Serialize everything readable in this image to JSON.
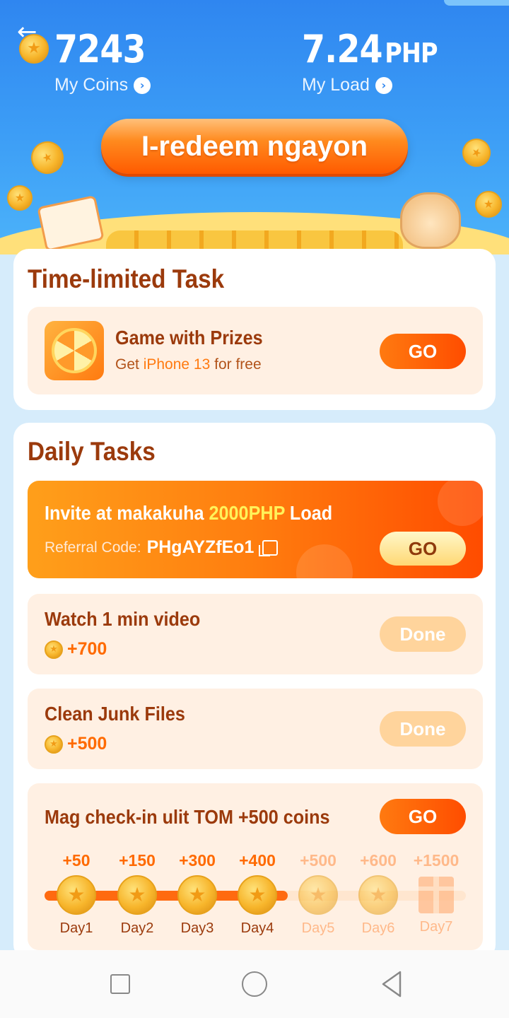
{
  "header": {
    "back_icon": "arrow-left-icon",
    "coins_value": "7243",
    "coins_label": "My Coins",
    "load_value": "7.24",
    "load_unit": "PHP",
    "load_label": "My Load",
    "redeem_label": "I-redeem ngayon"
  },
  "time_limited": {
    "title": "Time-limited Task",
    "task": {
      "icon": "prize-wheel-icon",
      "title": "Game with Prizes",
      "subtitle_prefix": "Get ",
      "subtitle_highlight": "iPhone 13",
      "subtitle_suffix": " for free",
      "button": "GO"
    }
  },
  "daily": {
    "title": "Daily Tasks",
    "invite": {
      "title_prefix": "Invite at makakuha ",
      "title_amount": "2000PHP",
      "title_suffix": " Load",
      "referral_label": "Referral Code:",
      "referral_code": "PHgAYZfEo1",
      "button": "GO"
    },
    "tasks": [
      {
        "title": "Watch 1 min video",
        "reward": "+700",
        "button": "Done"
      },
      {
        "title": "Clean Junk Files",
        "reward": "+500",
        "button": "Done"
      }
    ],
    "checkin": {
      "title": "Mag check-in ulit TOM +500 coins",
      "button": "GO",
      "completed_days": 4,
      "days": [
        {
          "points": "+50",
          "name": "Day1"
        },
        {
          "points": "+150",
          "name": "Day2"
        },
        {
          "points": "+300",
          "name": "Day3"
        },
        {
          "points": "+400",
          "name": "Day4"
        },
        {
          "points": "+500",
          "name": "Day5"
        },
        {
          "points": "+600",
          "name": "Day6"
        },
        {
          "points": "+1500",
          "name": "Day7"
        }
      ]
    }
  },
  "colors": {
    "header_blue": "#2f86f0",
    "accent_orange": "#ff6a00",
    "title_brown": "#9b3a0c"
  },
  "navbar": {
    "icons": [
      "recent-apps-icon",
      "home-icon",
      "back-icon"
    ]
  }
}
